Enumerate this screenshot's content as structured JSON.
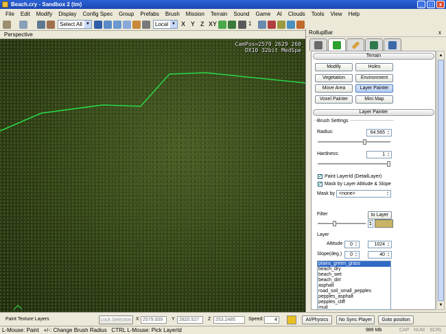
{
  "window": {
    "title": "Beach.cry - Sandbox 2 (tm)",
    "min": "_",
    "max": "□",
    "close": "x"
  },
  "menu": [
    "File",
    "Edit",
    "Modify",
    "Display",
    "Config Spec",
    "Group",
    "Prefabs",
    "Brush",
    "Mission",
    "Terrain",
    "Sound",
    "Game",
    "AI",
    "Clouds",
    "Tools",
    "View",
    "Help"
  ],
  "toolbar": {
    "select_mode": "Select All",
    "coord_space": "Local",
    "axes": [
      "X",
      "Y",
      "Z",
      "XY"
    ],
    "grid_value": "1"
  },
  "viewport": {
    "label": "Perspective",
    "hud_line1": "CamPos=2579 2629 260",
    "hud_line2": "DX10 32bit MedSpe"
  },
  "rollup": {
    "title": "RollupBar",
    "close": "x",
    "tabs": [
      "objects-icon",
      "terrain-icon",
      "modeling-icon",
      "display-icon",
      "layers-icon"
    ],
    "terrain_section": "Terrain",
    "terrain_buttons": [
      "Modify",
      "Holes",
      "Vegetation",
      "Environment",
      "Move Area",
      "Layer Painter",
      "Voxel Painter",
      "Mini Map"
    ],
    "layer_painter_section": "Layer Painter",
    "brush_settings": "Brush Settings",
    "radius_label": "Radius:",
    "radius_value": "64.565",
    "radius_fraction": 0.65,
    "hardness_label": "Hardness:",
    "hardness_value": "1",
    "hardness_fraction": 1.0,
    "paint_layer_label": "Paint LayerId (DetailLayer)",
    "mask_altitude_label": "Mask by Layer Altitude & Slope",
    "mask_by_label": "Mask by",
    "mask_by_value": "<none>",
    "filter_label": "Filter",
    "to_layer_button": "to Layer",
    "filter_value": "1",
    "filter_color": "#c8b464",
    "layer_label": "Layer",
    "altitude_label": "Altitude",
    "altitude_min": "0",
    "altitude_max": "1024",
    "slope_label": "Slope(deg.)",
    "slope_min": "0",
    "slope_max": "40",
    "layers": [
      "plains_green_grass",
      "beach_dry",
      "beach_wet",
      "beach_dirt",
      "asphalt",
      "road_soil_small_pepples",
      "pepples_asphalt",
      "pepples_cliff",
      "mud"
    ]
  },
  "statusrow": {
    "mode_label": "Paint Texture Layers",
    "lock_selection": "Lock Selection",
    "x_label": "X",
    "x_value": "2579.009",
    "y_label": "Y",
    "y_value": "2820.527",
    "z_label": "Z",
    "z_value": "253.2485",
    "speed_label": "Speed:",
    "speed_value": "4",
    "ai_physics": "AI/Physics",
    "no_sync_player": "No Sync Player",
    "goto_position": "Goto position"
  },
  "statusbar": {
    "hint": "L-Mouse: Paint   +/-: Change Brush Radius   CTRL L-Mouse: Pick LayerId",
    "memory": "989 Mb",
    "cap": "CAP",
    "num": "NUM",
    "scrl": "SCRL"
  },
  "colors": {
    "accent": "#3169c6",
    "title_bar": "#2b62d6",
    "terrain_line": "#29d94a"
  }
}
